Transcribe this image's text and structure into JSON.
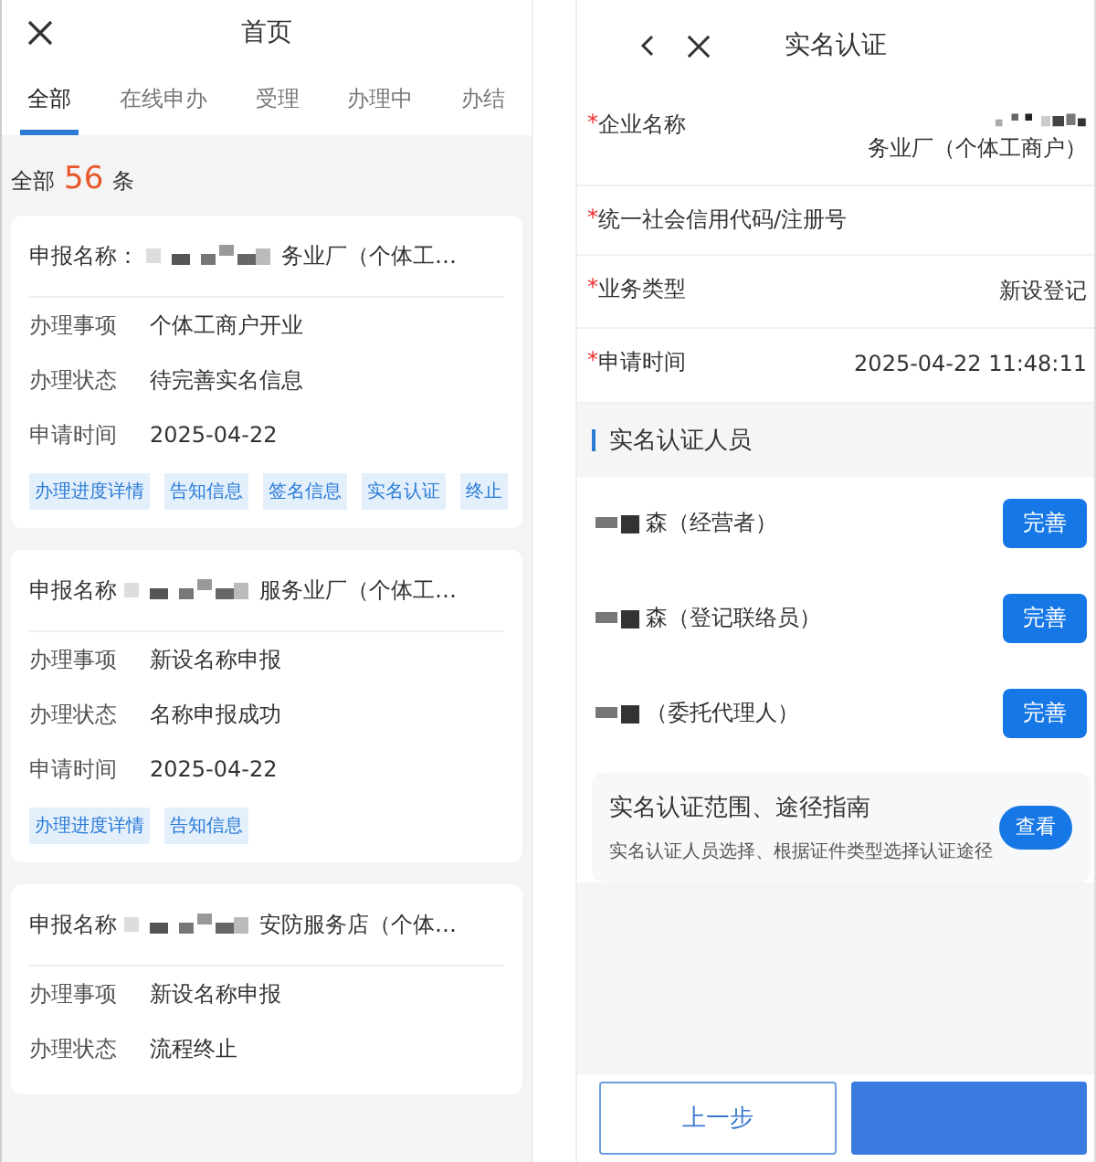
{
  "left": {
    "title": "首页",
    "tabs": [
      {
        "label": "全部",
        "selected": true
      },
      {
        "label": "在线申办",
        "selected": false
      },
      {
        "label": "受理",
        "selected": false
      },
      {
        "label": "办理中",
        "selected": false
      },
      {
        "label": "办结",
        "selected": false
      }
    ],
    "count_label": "全部",
    "count": "56",
    "count_unit": "条",
    "cards": [
      {
        "name_label": "申报名称：",
        "redacted": true,
        "name": "务业厂（个体工…",
        "fields": [
          {
            "label": "办理事项",
            "value": "个体工商户开业"
          },
          {
            "label": "办理状态",
            "value": "待完善实名信息"
          },
          {
            "label": "申请时间",
            "value": "2025-04-22"
          }
        ],
        "tags": [
          "办理进度详情",
          "告知信息",
          "签名信息",
          "实名认证",
          "终止"
        ]
      },
      {
        "name_label": "申报名称",
        "redacted": true,
        "name": "服务业厂（个体工…",
        "fields": [
          {
            "label": "办理事项",
            "value": "新设名称申报"
          },
          {
            "label": "办理状态",
            "value": "名称申报成功"
          },
          {
            "label": "申请时间",
            "value": "2025-04-22"
          }
        ],
        "tags": [
          "办理进度详情",
          "告知信息"
        ]
      },
      {
        "name_label": "申报名称",
        "redacted": true,
        "name": "安防服务店（个体…",
        "fields": [
          {
            "label": "办理事项",
            "value": "新设名称申报"
          },
          {
            "label": "办理状态",
            "value": "流程终止"
          }
        ]
      }
    ]
  },
  "right": {
    "title": "实名认证",
    "fields": [
      {
        "mark": "*",
        "label": "企业名称",
        "redacted": true,
        "value": "务业厂（个体工商户）"
      },
      {
        "mark": "*",
        "label": "统一社会信用代码/注册号"
      },
      {
        "mark": "*",
        "label": "业务类型",
        "value": "新设登记"
      },
      {
        "mark": "*",
        "label": "申请时间",
        "value": "2025-04-22 11:48:11"
      }
    ],
    "section": "实名认证人员",
    "people": [
      {
        "name": "森（经营者）",
        "redacted": true,
        "button": "完善"
      },
      {
        "name": "森（登记联络员）",
        "redacted": true,
        "button": "完善"
      },
      {
        "name": "（委托代理人）",
        "redacted": true,
        "button": "完善"
      }
    ],
    "guide": {
      "title": "实名认证范围、途径指南",
      "description": "实名认证人员选择、根据证件类型选择认证途径",
      "button": "查看"
    },
    "back_button": "上一步"
  }
}
